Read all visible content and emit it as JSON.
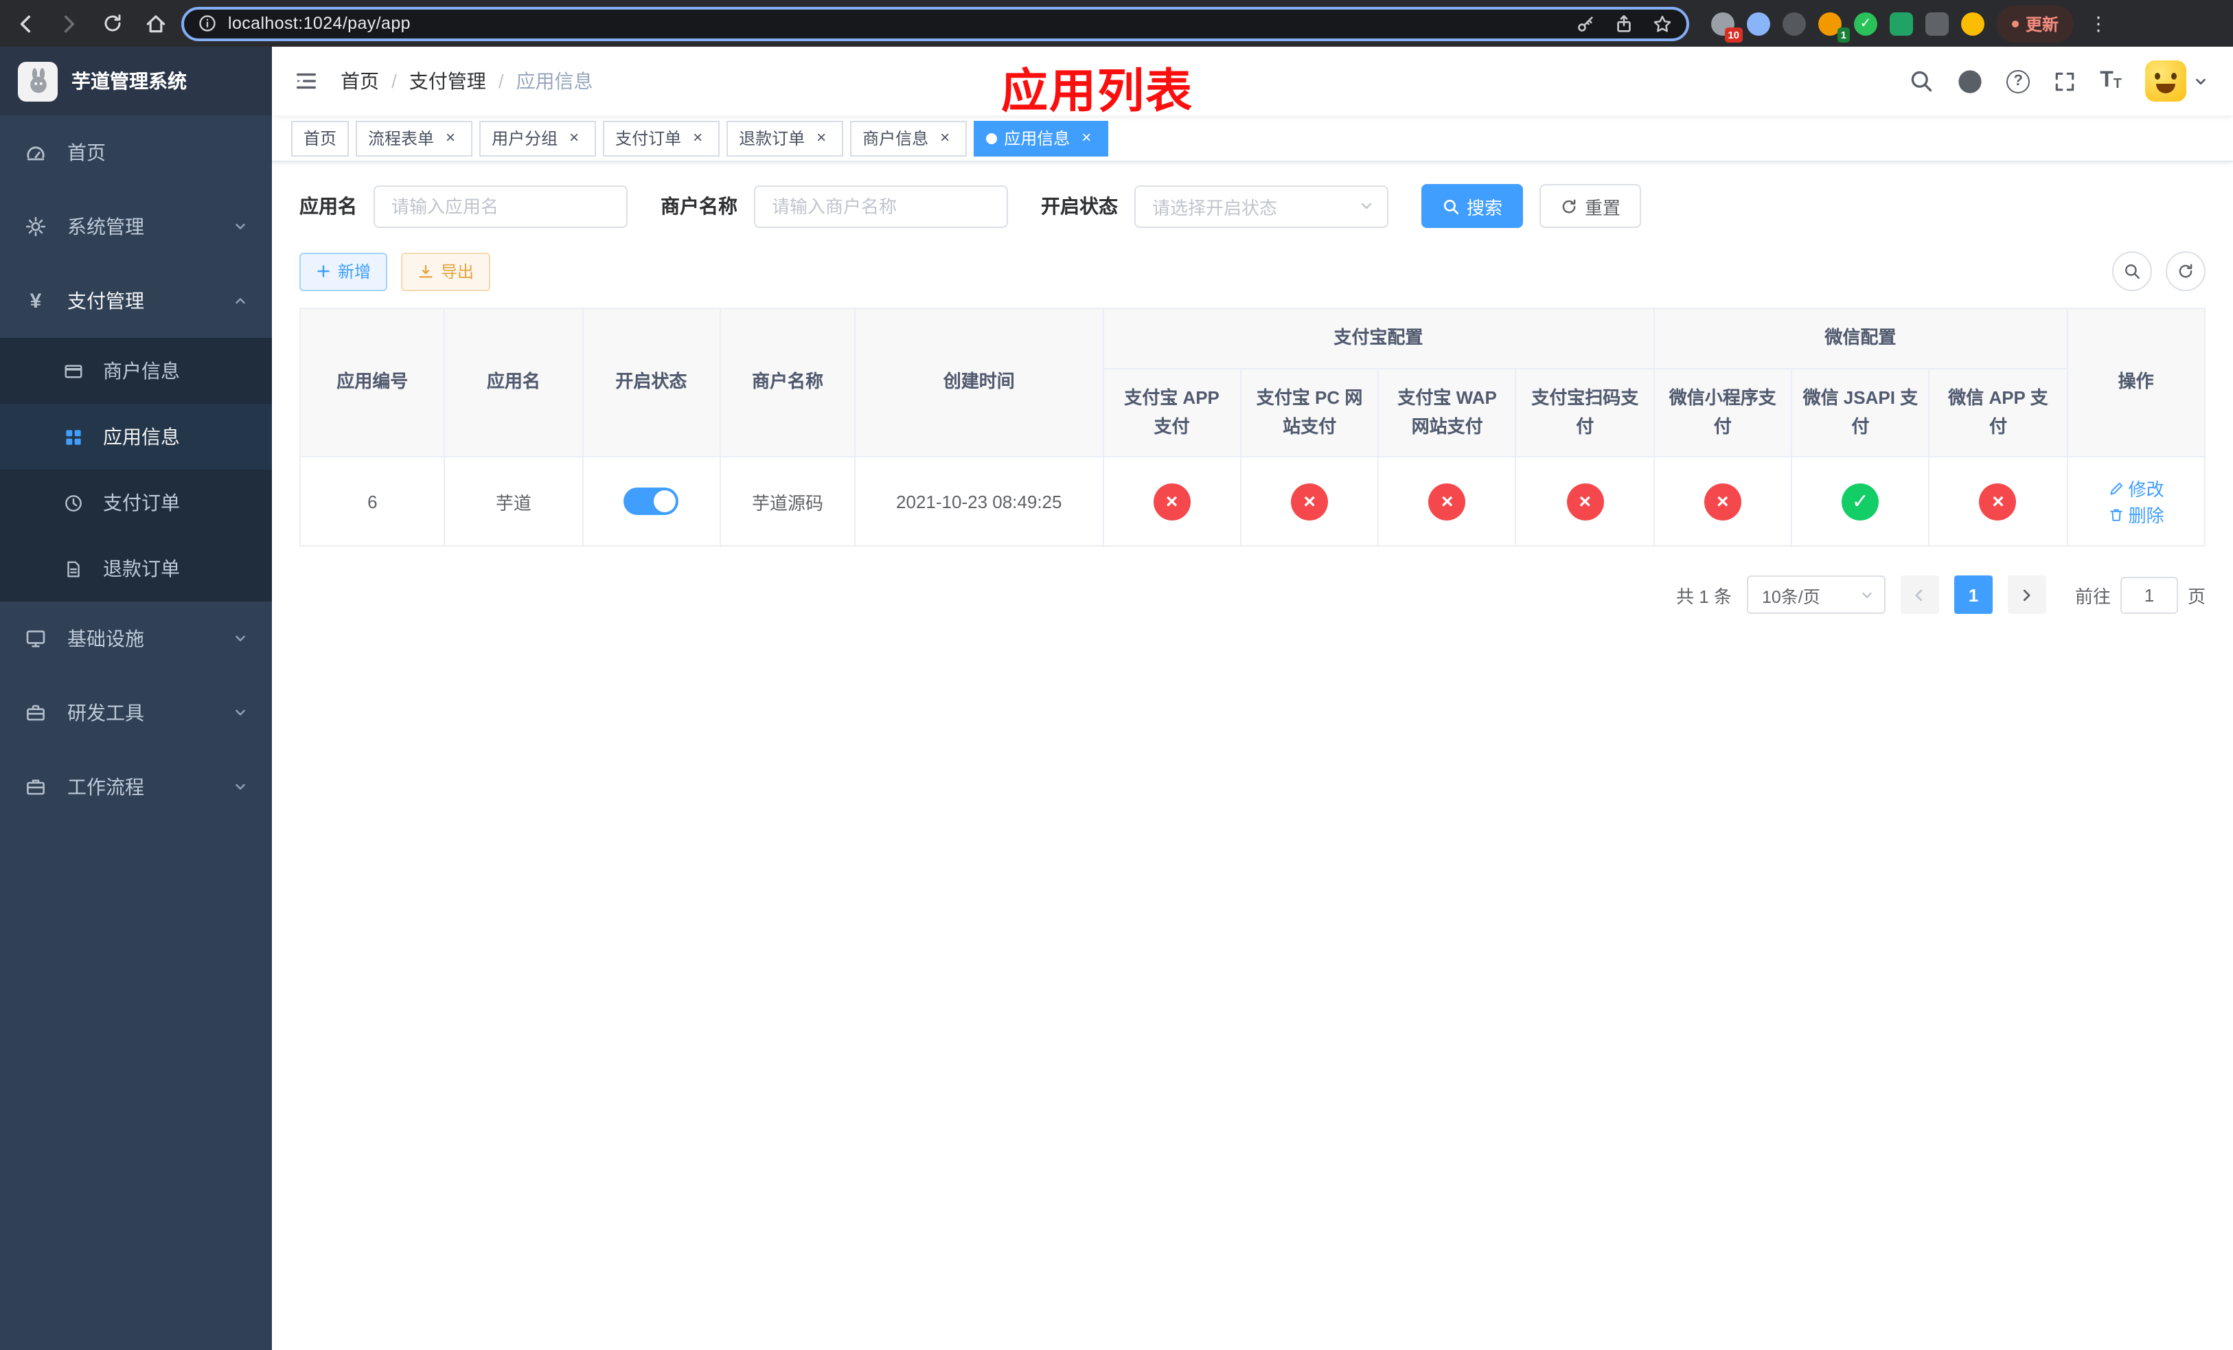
{
  "colors": {
    "accent": "#409eff",
    "danger": "#f5484d",
    "success": "#13ce66",
    "sidebar_bg": "#304156",
    "submenu_bg": "#1f2d3d",
    "overlay_red": "#fb0e0e"
  },
  "browser": {
    "url": "localhost:1024/pay/app",
    "update_label": "更新",
    "ext_badge_1": "10",
    "ext_badge_2": "1"
  },
  "logo": {
    "title": "芋道管理系统"
  },
  "sidebar": {
    "items": [
      {
        "label": "首页"
      },
      {
        "label": "系统管理"
      },
      {
        "label": "支付管理"
      },
      {
        "label": "基础设施"
      },
      {
        "label": "研发工具"
      },
      {
        "label": "工作流程"
      }
    ],
    "payment_children": [
      {
        "label": "商户信息"
      },
      {
        "label": "应用信息"
      },
      {
        "label": "支付订单"
      },
      {
        "label": "退款订单"
      }
    ]
  },
  "navbar": {
    "breadcrumb": [
      {
        "label": "首页"
      },
      {
        "label": "支付管理"
      },
      {
        "label": "应用信息"
      }
    ]
  },
  "overlay": {
    "title": "应用列表"
  },
  "tabs": [
    {
      "label": "首页"
    },
    {
      "label": "流程表单"
    },
    {
      "label": "用户分组"
    },
    {
      "label": "支付订单"
    },
    {
      "label": "退款订单"
    },
    {
      "label": "商户信息"
    },
    {
      "label": "应用信息"
    }
  ],
  "filters": {
    "app_name_label": "应用名",
    "app_name_placeholder": "请输入应用名",
    "merchant_label": "商户名称",
    "merchant_placeholder": "请输入商户名称",
    "status_label": "开启状态",
    "status_placeholder": "请选择开启状态",
    "search_label": "搜索",
    "reset_label": "重置"
  },
  "toolbar": {
    "add_label": "新增",
    "export_label": "导出"
  },
  "table": {
    "headers": {
      "app_id": "应用编号",
      "app_name": "应用名",
      "status": "开启状态",
      "merchant": "商户名称",
      "created": "创建时间",
      "alipay_group": "支付宝配置",
      "wechat_group": "微信配置",
      "alipay_app": "支付宝 APP 支付",
      "alipay_pc": "支付宝 PC 网站支付",
      "alipay_wap": "支付宝 WAP 网站支付",
      "alipay_qr": "支付宝扫码支付",
      "wechat_lite": "微信小程序支付",
      "wechat_jsapi": "微信 JSAPI 支付",
      "wechat_app": "微信 APP 支付",
      "actions": "操作"
    },
    "row": {
      "app_id": "6",
      "app_name": "芋道",
      "status_on": true,
      "merchant": "芋道源码",
      "created": "2021-10-23 08:49:25",
      "config_states": [
        "fail",
        "fail",
        "fail",
        "fail",
        "fail",
        "success",
        "fail"
      ],
      "edit_label": "修改",
      "delete_label": "删除"
    }
  },
  "pagination": {
    "total": "共 1 条",
    "page_size": "10条/页",
    "page": "1",
    "goto_label": "前往",
    "goto_value": "1",
    "page_unit": "页"
  }
}
